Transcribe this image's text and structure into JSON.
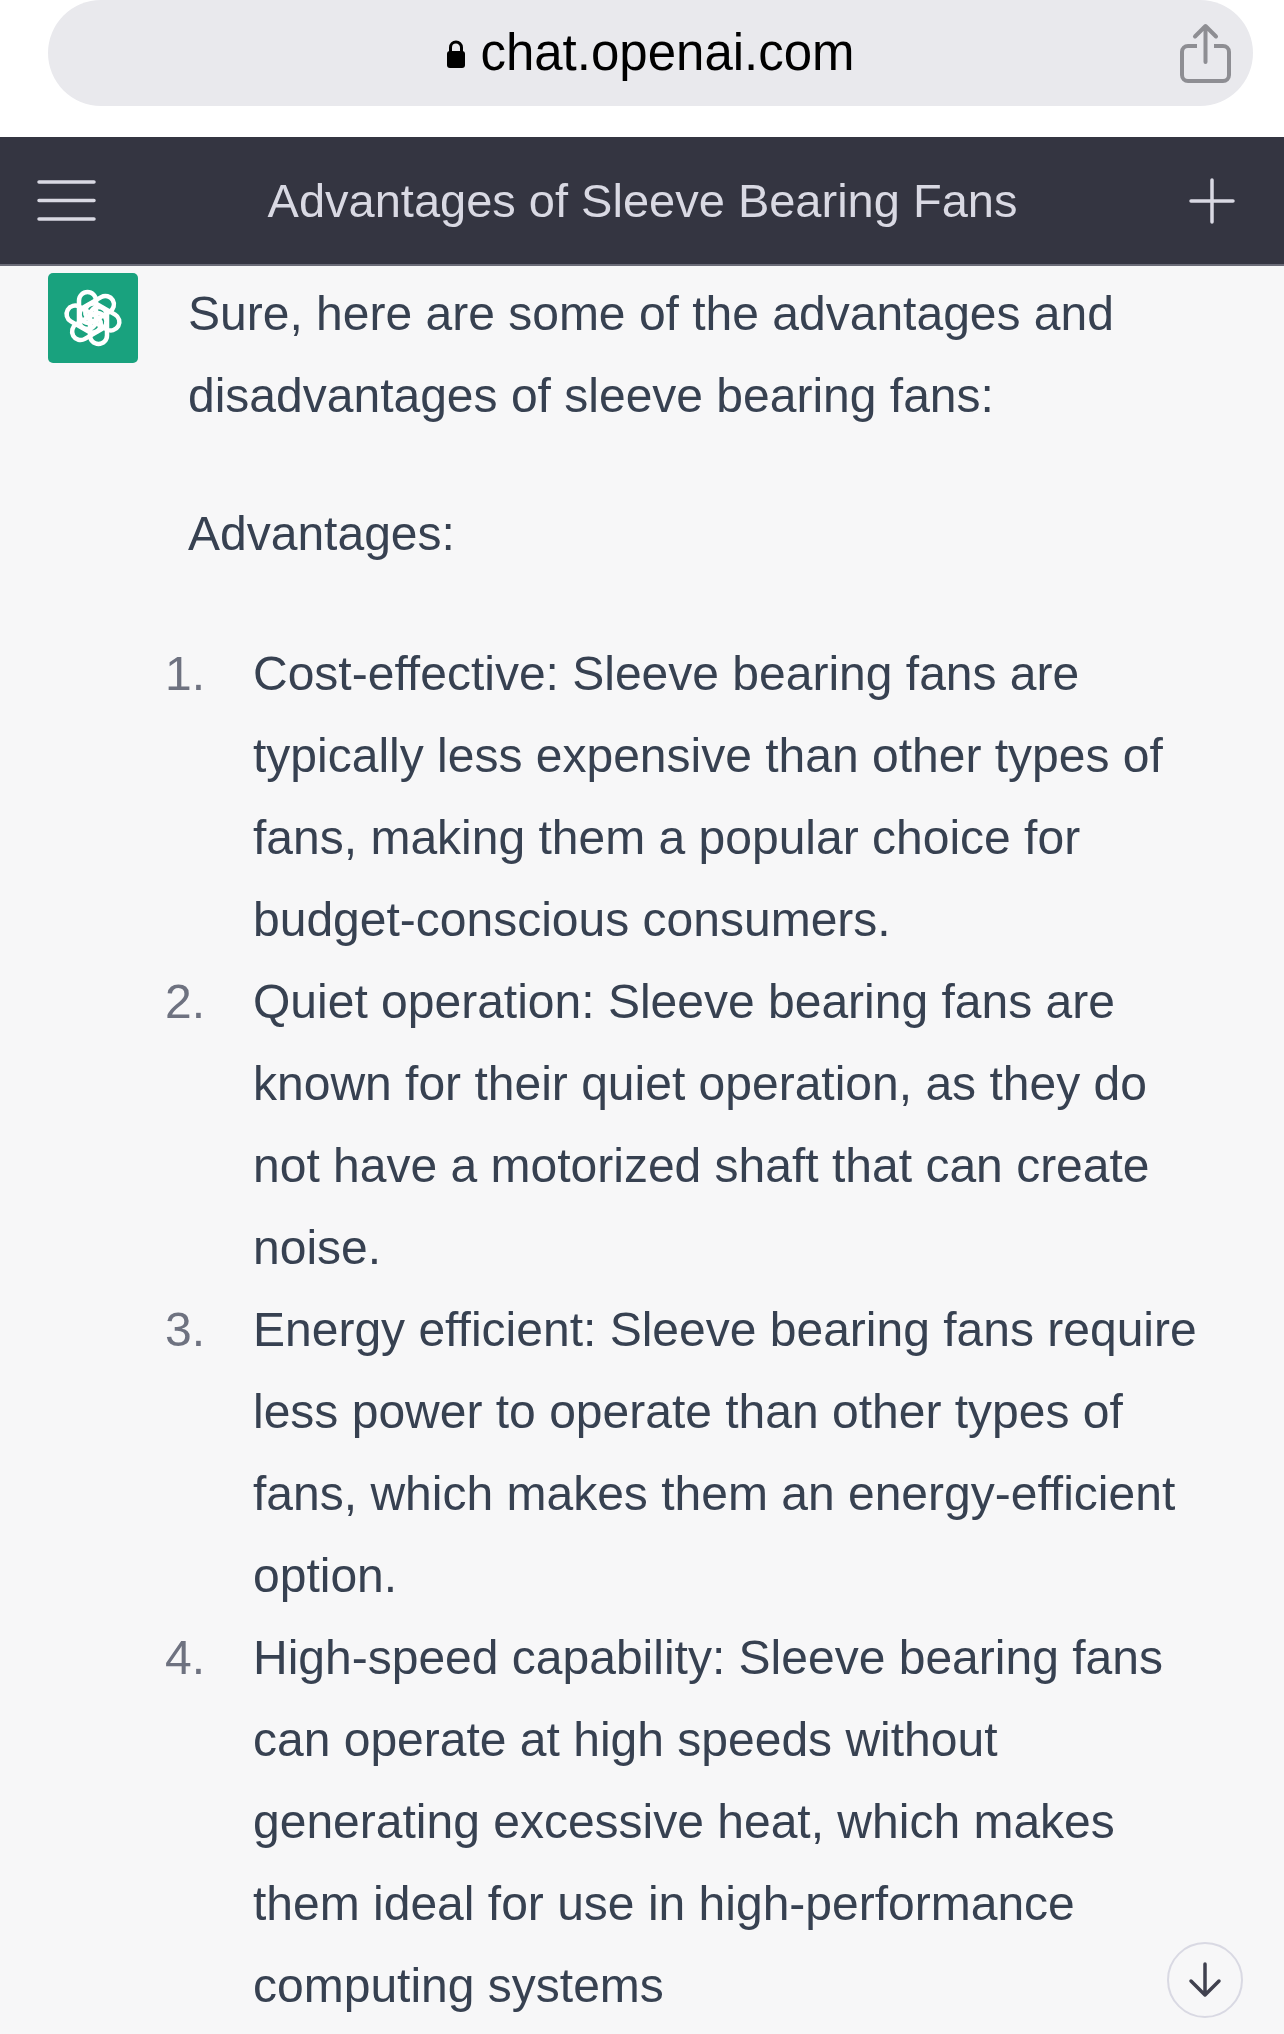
{
  "browser": {
    "url": "chat.openai.com"
  },
  "header": {
    "title": "Advantages of Sleeve Bearing Fans"
  },
  "message": {
    "intro": "Sure, here are some of the advantages and disadvantages of sleeve bearing fans:",
    "heading": "Advantages:",
    "items": [
      {
        "number": "1.",
        "text": "Cost-effective: Sleeve bearing fans are typically less expensive than other types of fans, making them a popular choice for budget-conscious consumers."
      },
      {
        "number": "2.",
        "text": "Quiet operation: Sleeve bearing fans are known for their quiet operation, as they do not have a motorized shaft that can create noise."
      },
      {
        "number": "3.",
        "text": "Energy efficient: Sleeve bearing fans require less power to operate than other types of fans, which makes them an energy-efficient option."
      },
      {
        "number": "4.",
        "text": "High-speed capability: Sleeve bearing fans can operate at high speeds without generating excessive heat, which makes them ideal for use in high-performance computing systems"
      }
    ]
  }
}
